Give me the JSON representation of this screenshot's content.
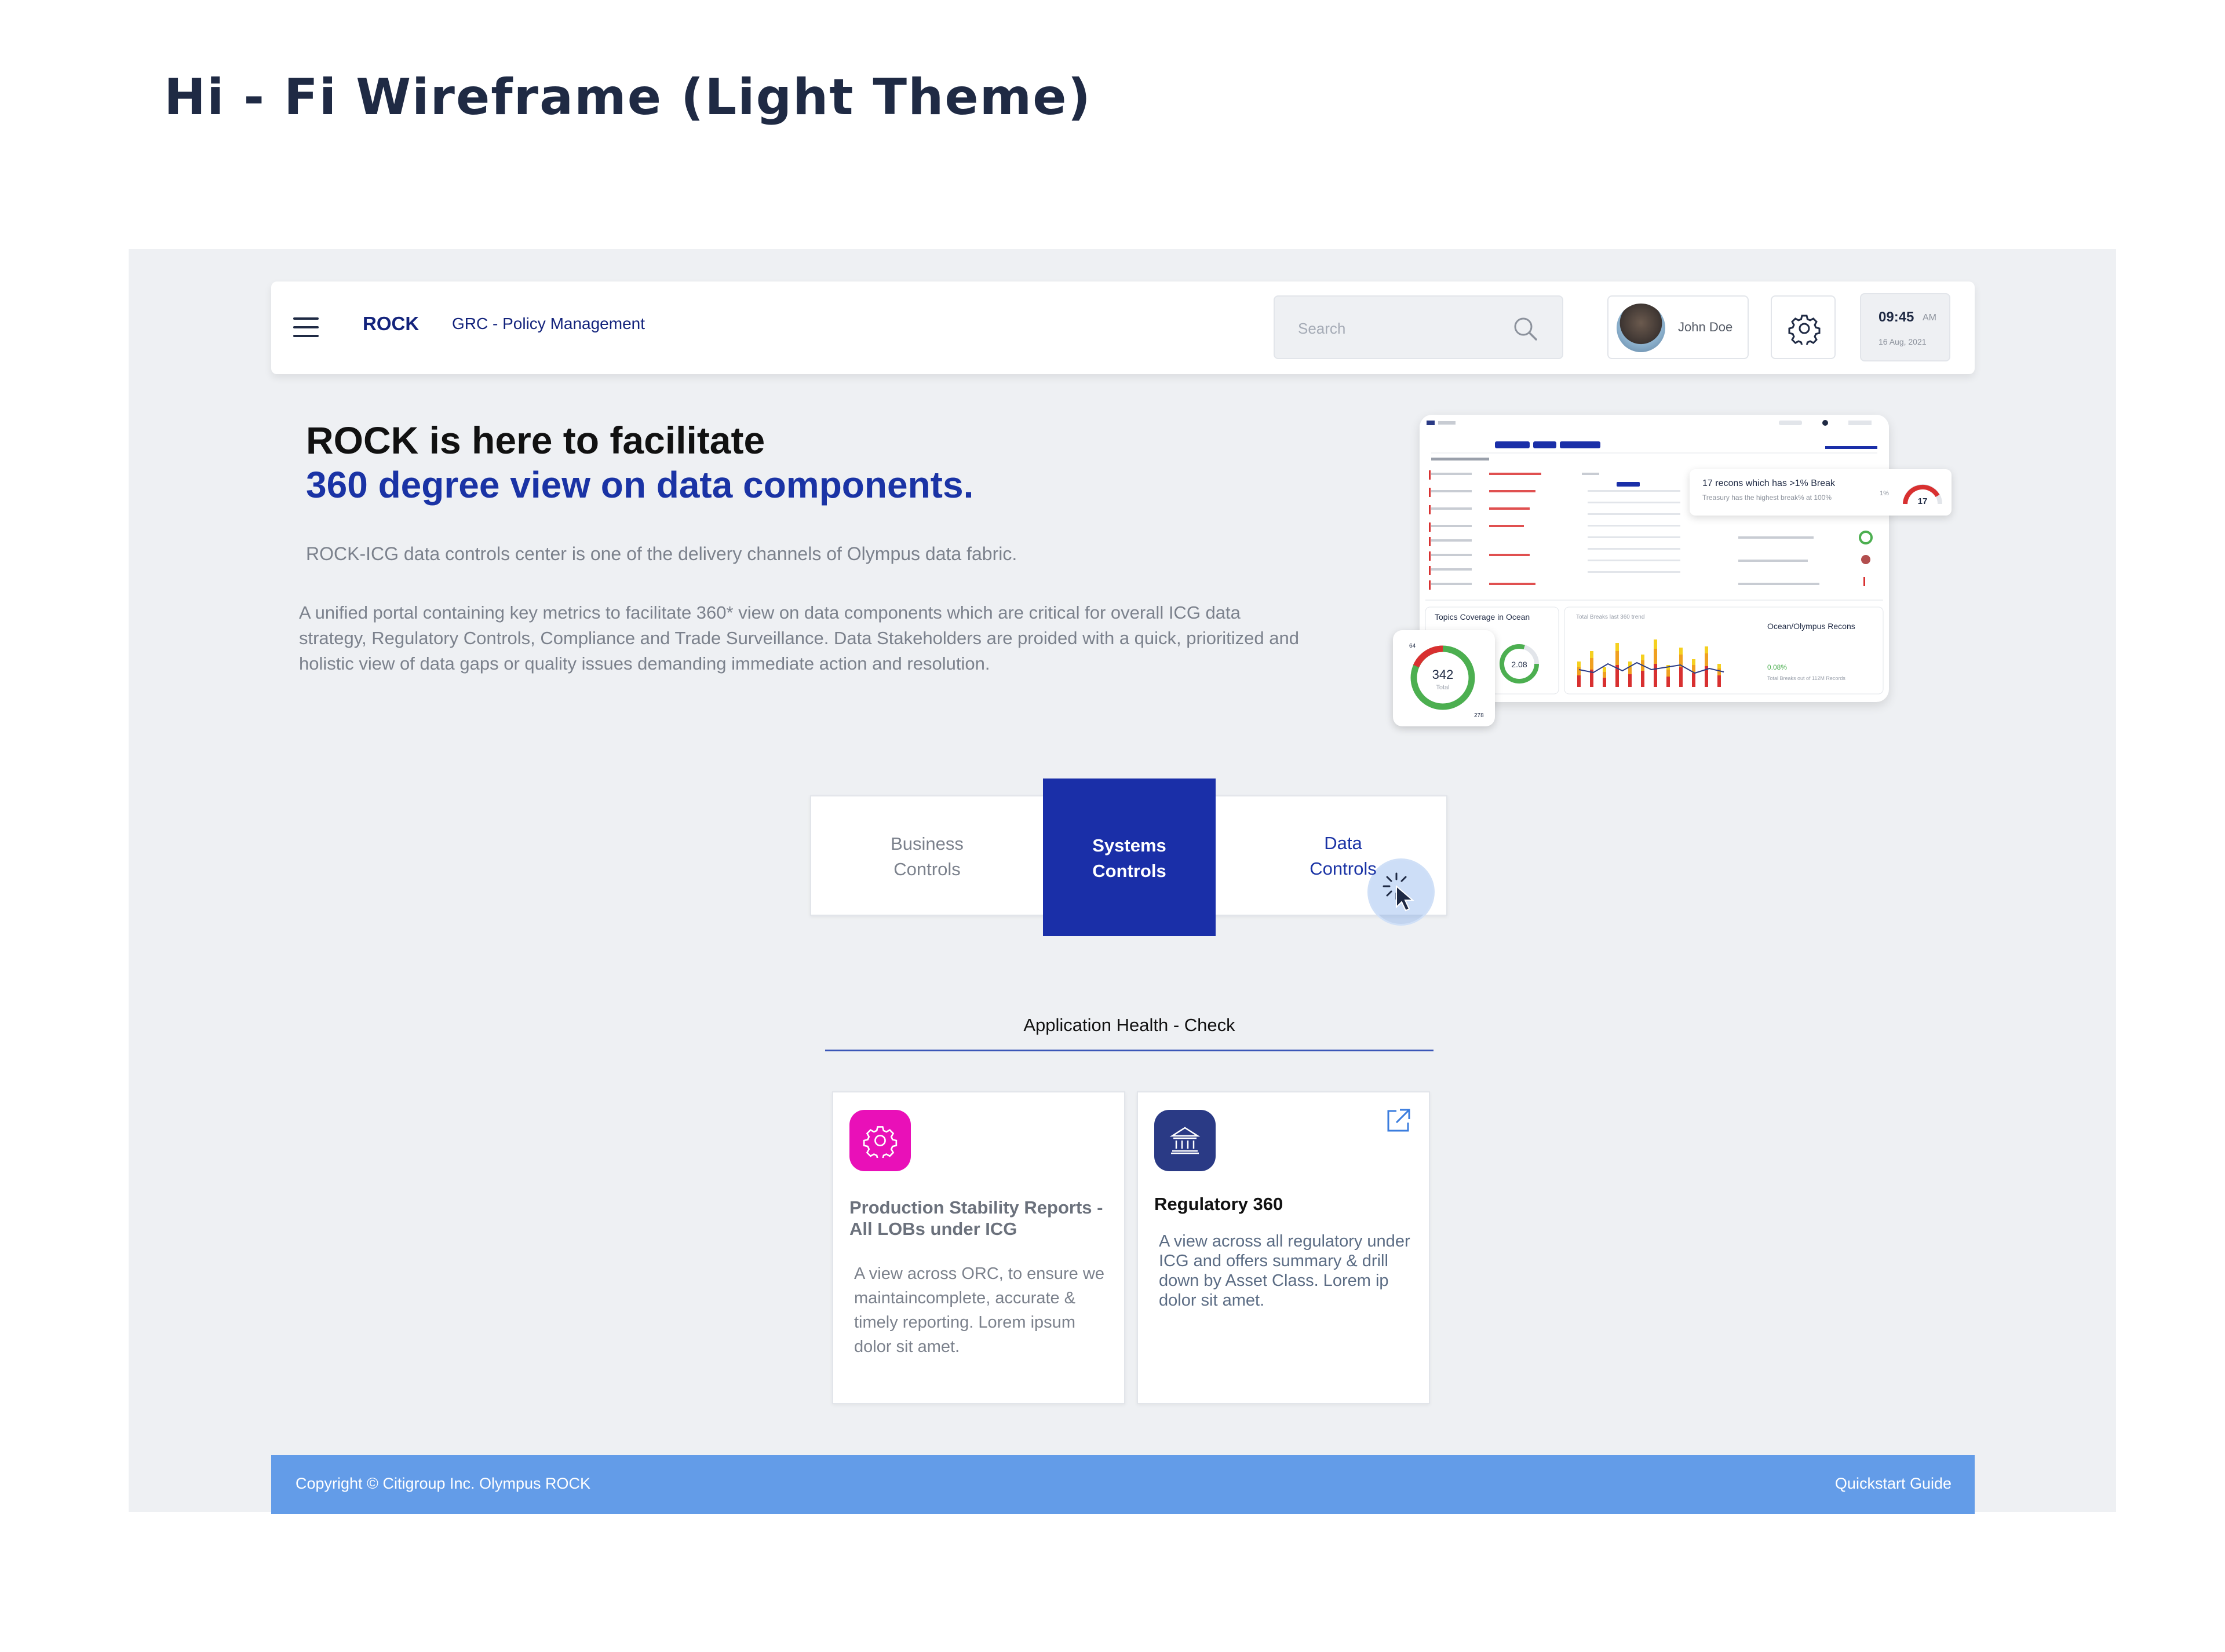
{
  "page_heading": "Hi - Fi Wireframe (Light Theme)",
  "header": {
    "brand": "ROCK",
    "breadcrumb": "GRC - Policy Management",
    "search_placeholder": "Search",
    "user_name": "John Doe",
    "time": "09:45",
    "ampm": "AM",
    "date": "16 Aug, 2021"
  },
  "hero": {
    "title_line1": "ROCK is here to facilitate",
    "title_line2": "360 degree view on data components.",
    "subtitle": "ROCK-ICG data controls center is one of the delivery channels of Olympus data fabric.",
    "description": "A unified portal containing key metrics to facilitate 360* view on data components which are critical for overall ICG data strategy, Regulatory Controls, Compliance and Trade Surveillance. Data Stakeholders are proided with a quick, prioritized and holistic view of data gaps or quality issues demanding immediate action and resolution."
  },
  "preview": {
    "callout_title": "17 recons which has >1% Break",
    "callout_text": "Treasury has the highest break% at 100%",
    "gauge_value": "17",
    "gauge_left": "1%",
    "topics_title": "Topics Coverage in Ocean",
    "ring_total": "342",
    "ring_total_label": "Total",
    "ring_top": "64",
    "ring_bottom": "278",
    "ring_small_value": "2.08",
    "ring_small_tag": "342",
    "breaks_title": "Total Breaks last 360 trend",
    "recons_title": "Ocean/Olympus Recons",
    "recons_value": "0.08%",
    "recons_text": "Total Breaks out of 112M Records"
  },
  "tabs": [
    {
      "line1": "Business",
      "line2": "Controls"
    },
    {
      "line1": "Systems",
      "line2": "Controls"
    },
    {
      "line1": "Data",
      "line2": "Controls"
    }
  ],
  "app_health": {
    "title": "Application Health - Check",
    "cards": [
      {
        "title": "Production Stability Reports - All LOBs under ICG",
        "description": "A view across ORC, to ensure we maintaincomplete, accurate & timely reporting. Lorem ipsum dolor sit amet.",
        "icon": "gear-icon",
        "color": "#e910b8"
      },
      {
        "title": "Regulatory 360",
        "description": "A view across all regulatory under ICG and offers summary & drill down by Asset Class. Lorem ip dolor sit amet.",
        "icon": "bank-icon",
        "color": "#2a3a85"
      }
    ]
  },
  "footer": {
    "copyright": "Copyright © Citigroup Inc. Olympus ROCK",
    "quickstart": "Quickstart Guide"
  },
  "colors": {
    "primary": "#1a2fa8",
    "footer": "#639ce8",
    "canvas": "#eef0f3",
    "accent_pink": "#e910b8"
  }
}
